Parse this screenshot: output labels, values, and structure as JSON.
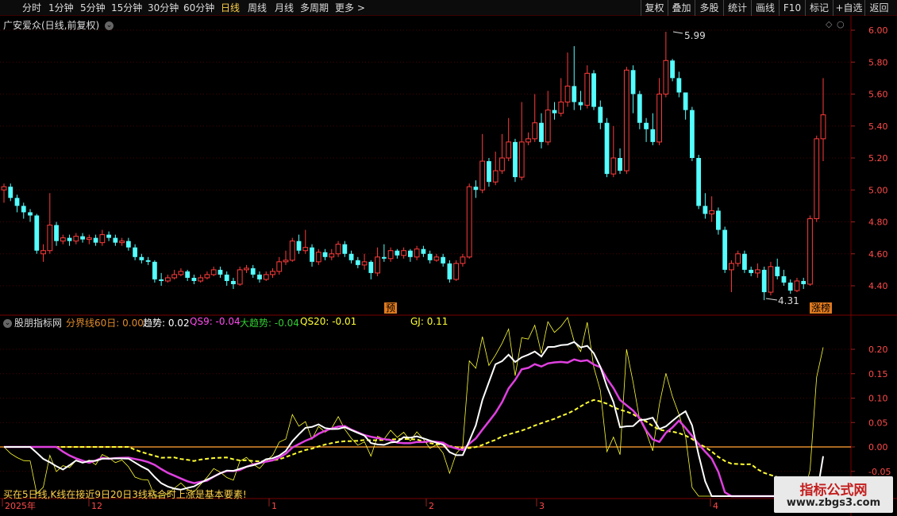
{
  "toolbar": {
    "tabs": [
      {
        "label": "分时"
      },
      {
        "label": "1分钟"
      },
      {
        "label": "5分钟"
      },
      {
        "label": "15分钟"
      },
      {
        "label": "30分钟"
      },
      {
        "label": "60分钟"
      },
      {
        "label": "日线",
        "active": true
      },
      {
        "label": "周线"
      },
      {
        "label": "月线"
      },
      {
        "label": "多周期"
      },
      {
        "label": "更多 >"
      }
    ],
    "buttons": [
      {
        "label": "复权"
      },
      {
        "label": "叠加"
      },
      {
        "label": "多股"
      },
      {
        "label": "统计"
      },
      {
        "label": "画线"
      },
      {
        "label": "F10"
      },
      {
        "label": "标记"
      },
      {
        "label": "+自选"
      },
      {
        "label": "返回"
      }
    ]
  },
  "kline": {
    "title": "广安爱众(日线,前复权)",
    "high_label": "5.99",
    "low_label": "4.31",
    "y_ticks": [
      "6.00",
      "5.80",
      "5.60",
      "5.40",
      "5.20",
      "5.00",
      "4.80",
      "4.60",
      "4.40"
    ],
    "marker_yu": "预",
    "marker_zhangting": "涨榜",
    "up_color": "#ff3c3c",
    "down_color": "#54ffff"
  },
  "indicator": {
    "name": "股朋指标网",
    "legend": [
      {
        "label": "分界线60日: 0.00",
        "color": "#e08a2a"
      },
      {
        "label": "趋势: 0.02",
        "color": "#ffffff"
      },
      {
        "label": "QS9: -0.04",
        "color": "#ff4df0"
      },
      {
        "label": "大趋势: -0.04",
        "color": "#33cc33"
      },
      {
        "label": "QS20: -0.01",
        "color": "#ffff33"
      },
      {
        "label": "GJ: 0.11",
        "color": "#ffff33"
      }
    ],
    "y_ticks": [
      "0.20",
      "0.15",
      "0.10",
      "0.05",
      "0.00",
      "-0.05"
    ]
  },
  "time_axis": {
    "labels": [
      "2025年",
      "12",
      "1",
      "2",
      "3",
      "4"
    ]
  },
  "bottom_note": "买在5日线,K线在接近9日20日3线粘合时上涨是基本要素!",
  "watermark": {
    "title": "指标公式网",
    "url": "www.zbgs3.com"
  }
}
